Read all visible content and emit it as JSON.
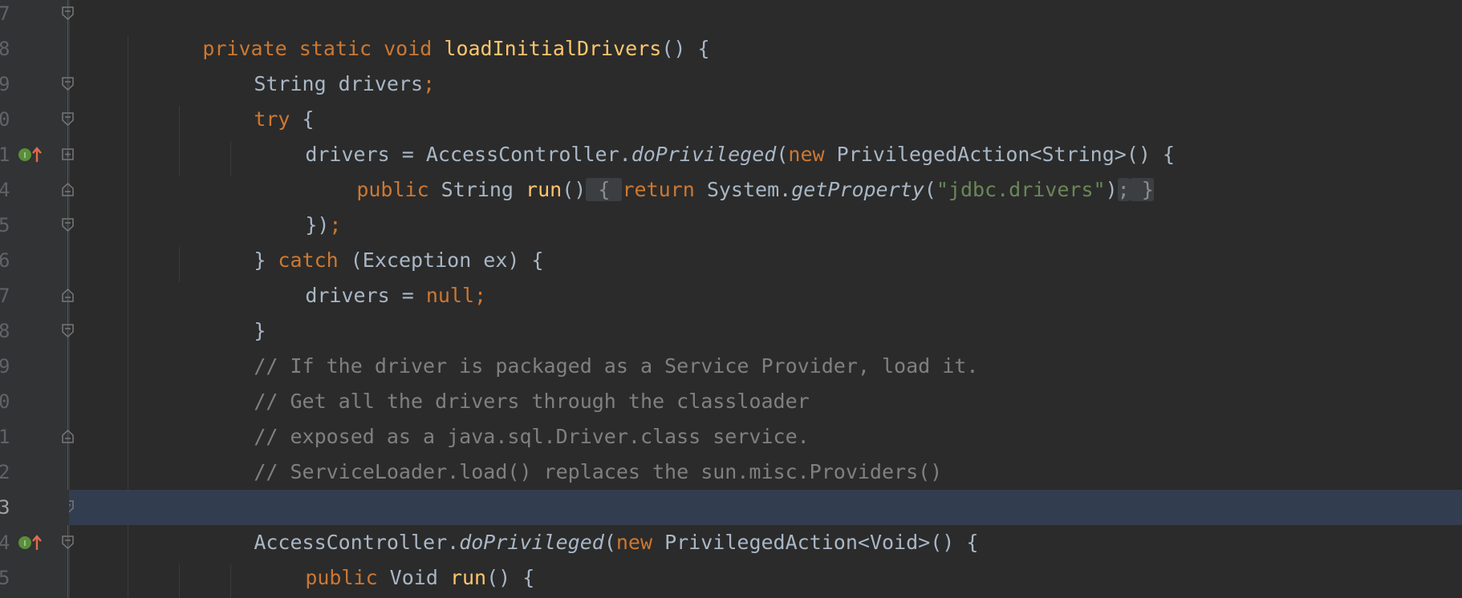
{
  "editor": {
    "lines": [
      {
        "number": "7",
        "tokens": [
          "private",
          "static",
          "void",
          "loadInitialDrivers",
          "() {"
        ]
      },
      {
        "number": "8",
        "tokens": [
          "String drivers",
          ";"
        ]
      },
      {
        "number": "9",
        "tokens": [
          "try",
          " {"
        ]
      },
      {
        "number": "0",
        "tokens": [
          "drivers = AccessController.",
          "doPrivileged",
          "(",
          "new",
          " PrivilegedAction<String>() {"
        ]
      },
      {
        "number": "1",
        "tokens": [
          "public",
          " String ",
          "run",
          "()",
          " { ",
          "return",
          " System.",
          "getProperty",
          "(",
          "\"jdbc.drivers\"",
          ")",
          ";",
          " }"
        ]
      },
      {
        "number": "4",
        "tokens": [
          "})",
          ";"
        ]
      },
      {
        "number": "5",
        "tokens": [
          "} ",
          "catch",
          " (Exception ex) {"
        ]
      },
      {
        "number": "6",
        "tokens": [
          "drivers = ",
          "null",
          ";"
        ]
      },
      {
        "number": "7",
        "tokens": [
          "}"
        ]
      },
      {
        "number": "8",
        "tokens": [
          "// If the driver is packaged as a Service Provider, load it."
        ]
      },
      {
        "number": "9",
        "tokens": [
          "// Get all the drivers through the classloader"
        ]
      },
      {
        "number": "0",
        "tokens": [
          "// exposed as a java.sql.Driver.class service."
        ]
      },
      {
        "number": "1",
        "tokens": [
          "// ServiceLoader.load() replaces the sun.misc.Providers()"
        ]
      },
      {
        "number": "2",
        "tokens": []
      },
      {
        "number": "3",
        "tokens": [
          "AccessController.",
          "doPrivileged",
          "(",
          "new",
          " PrivilegedAction<Void>() {"
        ]
      },
      {
        "number": "4",
        "tokens": [
          "public",
          " Void ",
          "run",
          "() {"
        ]
      },
      {
        "number": "5",
        "tokens": []
      }
    ]
  },
  "colors": {
    "background": "#2b2b2b",
    "gutter": "#313335",
    "keyword": "#cc7832",
    "method": "#ffc66d",
    "text": "#a9b7c6",
    "string": "#6a8759",
    "comment": "#808080",
    "current_line": "#323d4f"
  },
  "icons": {
    "implements_marker": "implementation-up-arrow-icon",
    "fold_marker": "code-fold-icon"
  }
}
